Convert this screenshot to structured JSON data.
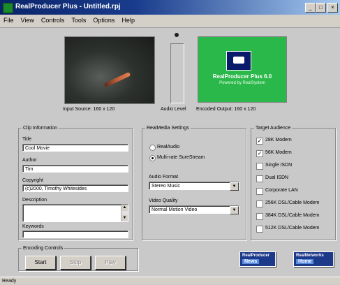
{
  "window": {
    "title": "RealProducer Plus - Untitled.rpj",
    "min_label": "_",
    "max_label": "□",
    "close_label": "×"
  },
  "menu": [
    "File",
    "View",
    "Controls",
    "Tools",
    "Options",
    "Help"
  ],
  "preview": {
    "input_caption": "Input Source: 160 x 120",
    "audio_caption": "Audio Level",
    "encoded_caption": "Encoded Output: 160 x 120",
    "encoded_title": "RealProducer Plus 6.0",
    "encoded_sub": "Powered by RealSystem"
  },
  "clip_info": {
    "legend": "Clip Information",
    "title_label": "Title",
    "title_value": "Cool Movie",
    "author_label": "Author",
    "author_value": "Tim",
    "copyright_label": "Copyright",
    "copyright_value": "(c)2000, Timothy Whitesides",
    "description_label": "Description",
    "description_value": "",
    "keywords_label": "Keywords",
    "keywords_value": ""
  },
  "realmedia": {
    "legend": "RealMedia Settings",
    "opt_realaudio": "RealAudio",
    "opt_multirate": "Multi-rate SureStream",
    "audio_format_label": "Audio Format",
    "audio_format_value": "Stereo Music",
    "video_quality_label": "Video Quality",
    "video_quality_value": "Normal Motion Video"
  },
  "target_audience": {
    "legend": "Target Audience",
    "items": [
      {
        "label": "28K Modem",
        "checked": true
      },
      {
        "label": "56K Modem",
        "checked": true
      },
      {
        "label": "Single ISDN",
        "checked": false
      },
      {
        "label": "Dual ISDN",
        "checked": false
      },
      {
        "label": "Corporate LAN",
        "checked": false
      },
      {
        "label": "256K DSL/Cable Modem",
        "checked": false
      },
      {
        "label": "384K DSL/Cable Modem",
        "checked": false
      },
      {
        "label": "512K DSL/Cable Modem",
        "checked": false
      }
    ]
  },
  "encoding": {
    "legend": "Encoding Controls",
    "start": "Start",
    "stop": "Stop",
    "play": "Play"
  },
  "badges": {
    "news_top": "RealProducer",
    "news_bottom": "News",
    "net_top": "RealNetworks",
    "net_bottom": "Home"
  },
  "status": {
    "text": "Ready"
  }
}
